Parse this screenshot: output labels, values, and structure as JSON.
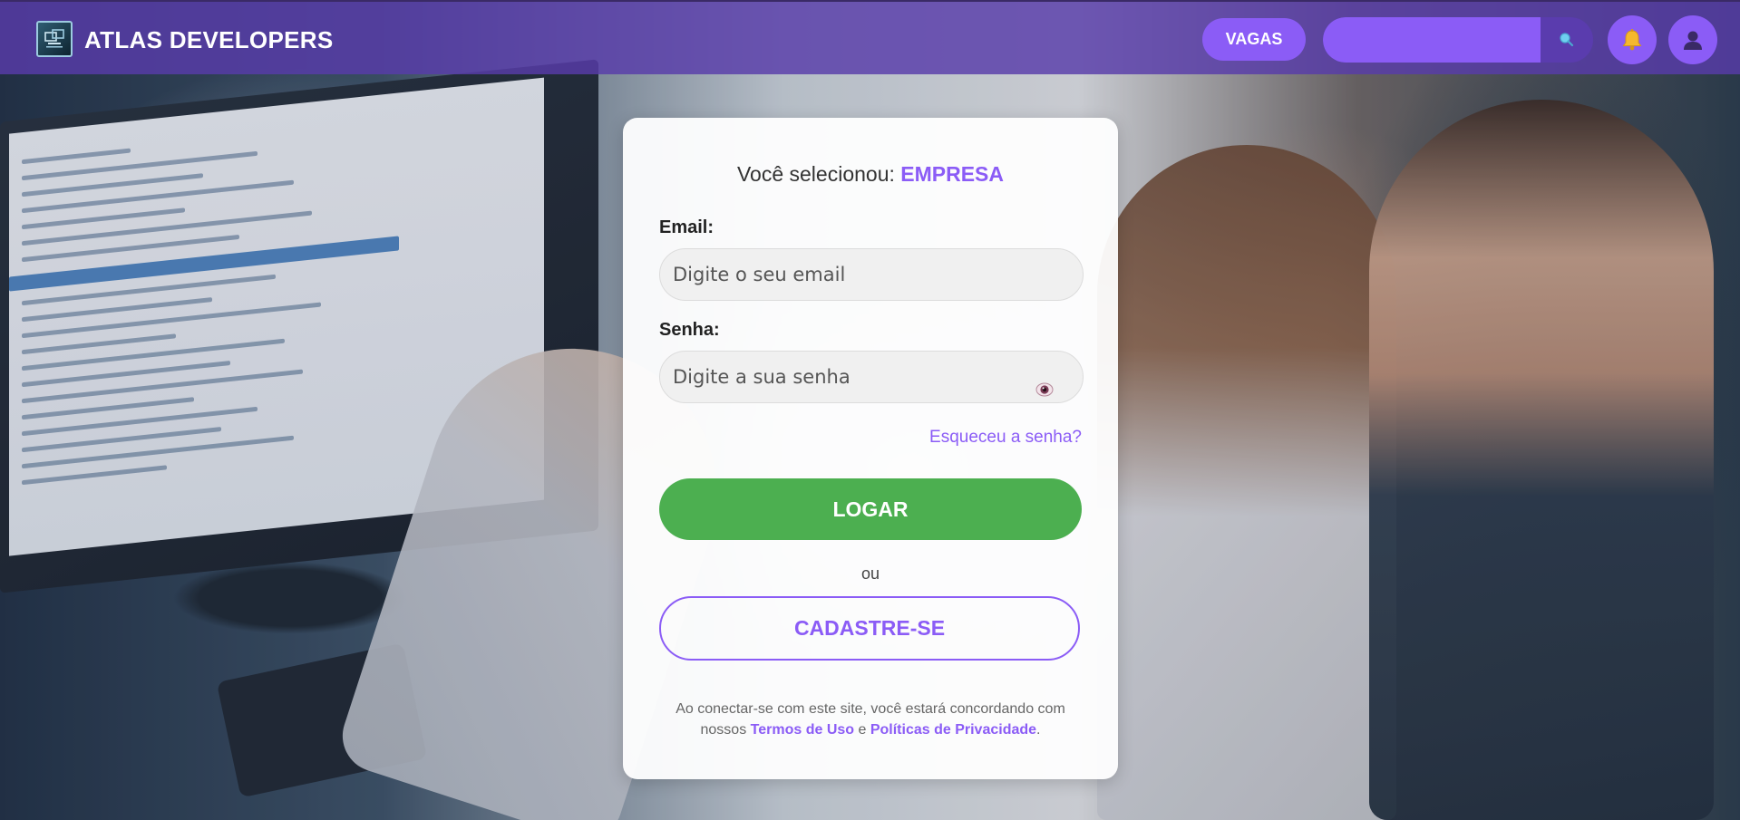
{
  "header": {
    "brand": "ATLAS DEVELOPERS",
    "vagas_label": "VAGAS",
    "search": {
      "value": "",
      "placeholder": ""
    },
    "icons": [
      "logo-icon",
      "search-icon",
      "bell-icon",
      "user-icon"
    ]
  },
  "login": {
    "selected_prefix": "Você selecionou: ",
    "selected_value": "EMPRESA",
    "email_label": "Email:",
    "email_placeholder": "Digite o seu email",
    "password_label": "Senha:",
    "password_placeholder": "Digite a sua senha",
    "forgot_label": "Esqueceu a senha?",
    "login_label": "LOGAR",
    "or_label": "ou",
    "signup_label": "CADASTRE-SE",
    "terms_prefix": "Ao conectar-se com este site, você estará concordando com nossos ",
    "terms_link": "Termos de Uso",
    "terms_and": " e ",
    "privacy_link": "Políticas de Privacidade",
    "terms_suffix": "."
  },
  "colors": {
    "header_bg": "#583caa",
    "accent": "#8b5cf6",
    "login_button": "#4caf50",
    "card_bg": "#ffffff"
  }
}
